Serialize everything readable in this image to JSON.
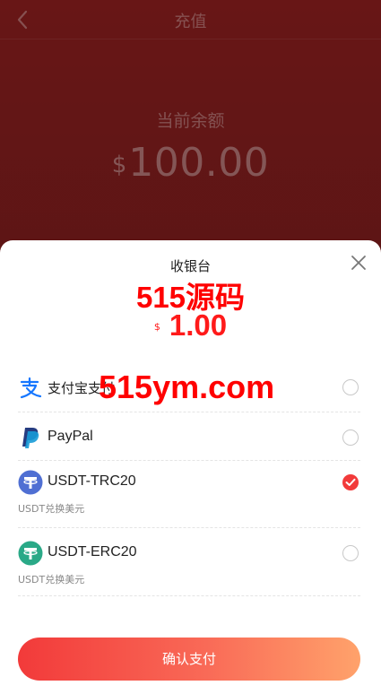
{
  "nav": {
    "title": "充值"
  },
  "balance": {
    "label": "当前余额",
    "currency": "$",
    "amount": "100.00"
  },
  "sheet": {
    "title": "收银台",
    "watermark_top": "515源码",
    "pay_currency": "$",
    "pay_amount": "1.00",
    "watermark_middle": "515ym.com",
    "methods": [
      {
        "label": "支付宝支付",
        "sub": "",
        "icon": "alipay-icon",
        "checked": false
      },
      {
        "label": "PayPal",
        "sub": "",
        "icon": "paypal-icon",
        "checked": false
      },
      {
        "label": "USDT-TRC20",
        "sub": "USDT兑换美元",
        "icon": "tether-icon",
        "checked": true
      },
      {
        "label": "USDT-ERC20",
        "sub": "USDT兑换美元",
        "icon": "tether-icon",
        "checked": false
      }
    ],
    "confirm_label": "确认支付"
  },
  "colors": {
    "accent": "#f23a3a",
    "gradient_end": "#ffa26b",
    "trc20": "#4f6fd3",
    "erc20": "#2aa987",
    "alipay": "#1677ff"
  }
}
